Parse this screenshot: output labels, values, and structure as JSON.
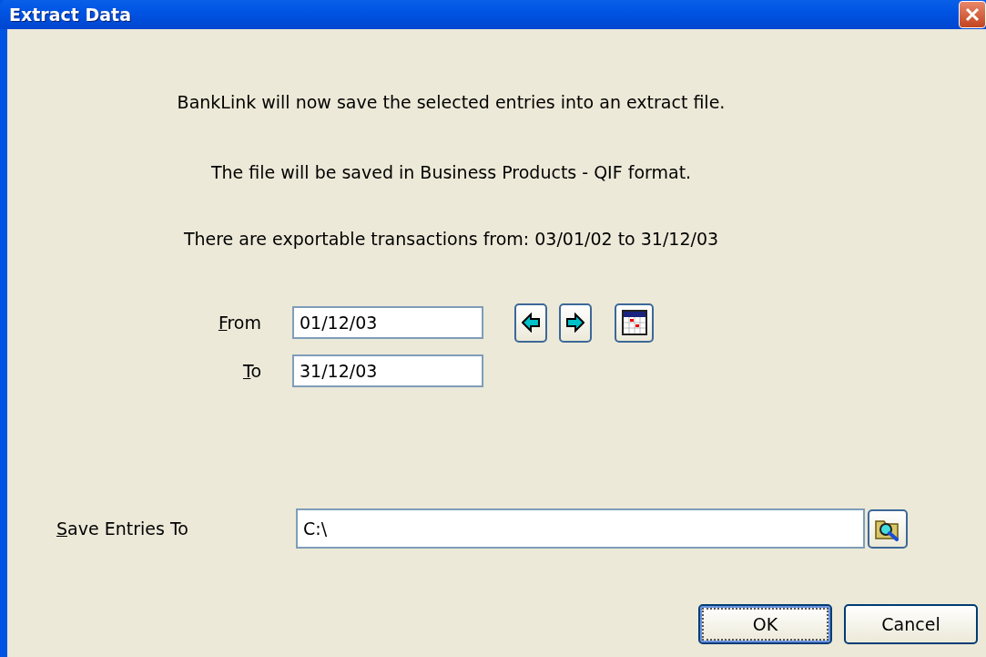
{
  "window": {
    "title": "Extract Data"
  },
  "messages": [
    "BankLink will now save the selected entries into an extract file.",
    "The file will be saved in Business Products - QIF format.",
    "There are exportable transactions from: 03/01/02 to 31/12/03"
  ],
  "date_range": [
    {
      "label": "From",
      "accelerator": true,
      "value": "01/12/03"
    },
    {
      "label": "To",
      "accelerator": true,
      "value": "31/12/03"
    }
  ],
  "save_to": {
    "label": "Save Entries To",
    "accelerator": true,
    "value": "C:\\"
  },
  "buttons": [
    {
      "label": "OK",
      "focused": true
    },
    {
      "label": "Cancel",
      "focused": false
    }
  ]
}
